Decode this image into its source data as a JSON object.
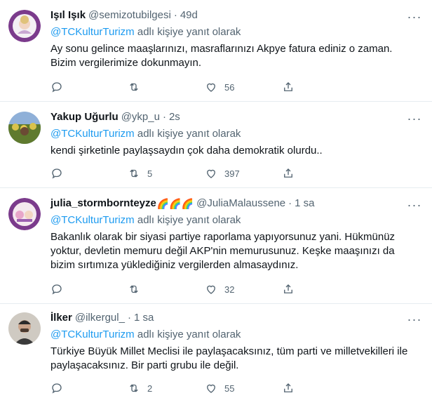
{
  "tweets": [
    {
      "name": "Işıl Işık",
      "handle": "@semizotubilgesi",
      "time": "49d",
      "reply_prefix": "@TCKulturTurizm",
      "reply_suffix": " adlı kişiye yanıt olarak",
      "text": "Ay sonu gelince maaşlarınızı, masraflarınızı Akpye fatura ediniz o zaman. Bizim vergilerimize dokunmayın.",
      "retweets": "",
      "likes": "56",
      "avatar_colors": [
        "#7b3b8c",
        "#f2d5c2"
      ]
    },
    {
      "name": "Yakup Uğurlu",
      "handle": "@ykp_u",
      "time": "2s",
      "reply_prefix": "@TCKulturTurizm",
      "reply_suffix": " adlı kişiye yanıt olarak",
      "text": "kendi şirketinle paylaşsaydın çok daha demokratik olurdu..",
      "retweets": "5",
      "likes": "397",
      "avatar_colors": [
        "#5f7a2e",
        "#d9c24a"
      ]
    },
    {
      "name": "julia_stormbornteyze",
      "rainbows": "🌈🌈🌈",
      "handle": "@JuliaMalaussene",
      "time": "1 sa",
      "reply_prefix": "@TCKulturTurizm",
      "reply_suffix": " adlı kişiye yanıt olarak",
      "text": "Bakanlık olarak bir siyasi partiye raporlama yapıyorsunuz yani. Hükmünüz yoktur, devletin memuru değil AKP'nin memurusunuz. Keşke maaşınızı da bizim sırtımıza yüklediğiniz vergilerden almasaydınız.",
      "retweets": "",
      "likes": "32",
      "avatar_colors": [
        "#7b3b8c",
        "#e7a6c9"
      ]
    },
    {
      "name": "İlker",
      "handle": "@ilkergul_",
      "time": "1 sa",
      "reply_prefix": "@TCKulturTurizm",
      "reply_suffix": " adlı kişiye yanıt olarak",
      "text": "Türkiye Büyük Millet Meclisi ile paylaşacaksınız, tüm parti ve milletvekilleri ile paylaşacaksınız. Bir parti grubu ile değil.",
      "retweets": "2",
      "likes": "55",
      "avatar_colors": [
        "#3a3a3a",
        "#d9d6d0"
      ]
    }
  ],
  "icons": {
    "reply": "reply-icon",
    "retweet": "retweet-icon",
    "like": "like-icon",
    "share": "share-icon",
    "more": "more-icon"
  }
}
